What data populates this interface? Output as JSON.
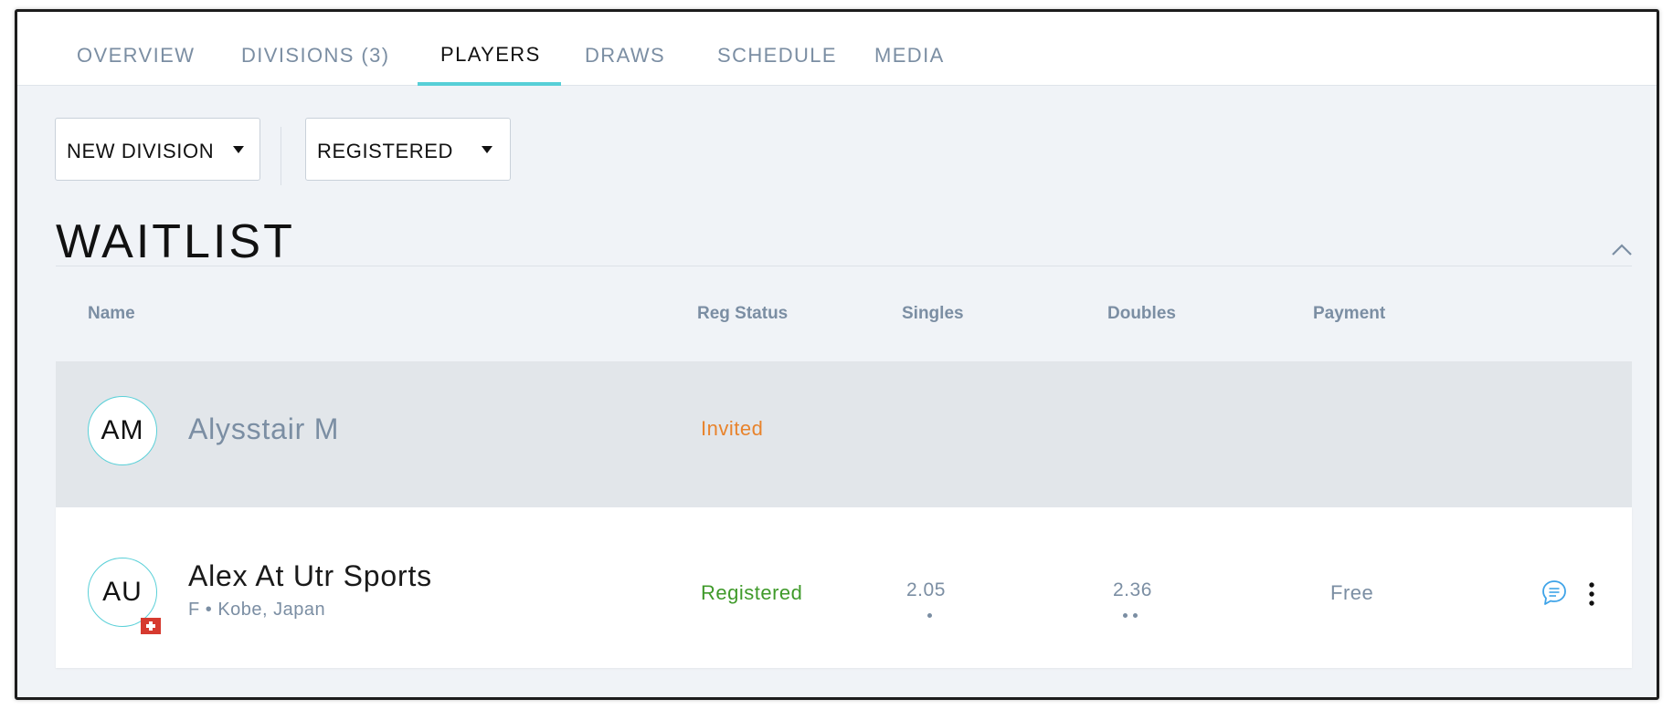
{
  "tabs": [
    {
      "label": "OVERVIEW"
    },
    {
      "label": "DIVISIONS (3)"
    },
    {
      "label": "PLAYERS"
    },
    {
      "label": "DRAWS"
    },
    {
      "label": "SCHEDULE"
    },
    {
      "label": "MEDIA"
    }
  ],
  "active_tab": "PLAYERS",
  "filters": {
    "division": "NEW DIVISION",
    "status": "REGISTERED"
  },
  "section": {
    "title": "WAITLIST"
  },
  "table": {
    "columns": [
      "Name",
      "Reg Status",
      "Singles",
      "Doubles",
      "Payment"
    ],
    "rows": [
      {
        "initials": "AM",
        "name": "Alysstair M",
        "subtitle": "",
        "status": "Invited",
        "singles": "",
        "doubles": "",
        "payment": ""
      },
      {
        "initials": "AU",
        "name": "Alex At Utr Sports",
        "subtitle": "F • Kobe, Japan",
        "status": "Registered",
        "singles": "2.05",
        "doubles": "2.36",
        "payment": "Free",
        "flag_icon": "swiss-flag-icon"
      }
    ]
  },
  "colors": {
    "accent": "#57cfd7",
    "invited": "#e8832c",
    "registered": "#3f9a2a",
    "muted": "#7b8ea3",
    "chat_icon": "#3ea3e8"
  }
}
